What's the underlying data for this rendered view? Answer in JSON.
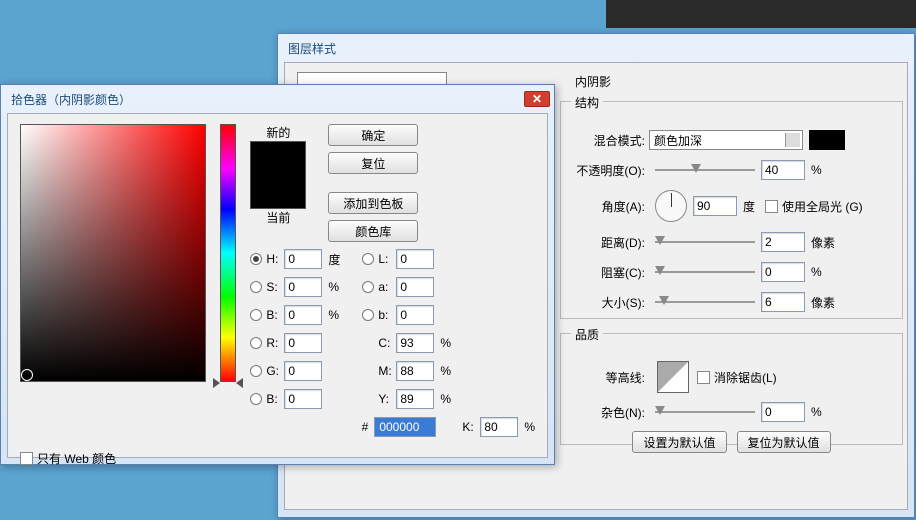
{
  "layerDialog": {
    "title": "图层样式",
    "section": "内阴影",
    "struct": {
      "legend": "结构",
      "blendModeLabel": "混合模式:",
      "blendMode": "颜色加深",
      "opacityLabel": "不透明度(O):",
      "opacity": "40",
      "opacityUnit": "%",
      "angleLabel": "角度(A):",
      "angle": "90",
      "angleUnit": "度",
      "globalLight": "使用全局光 (G)",
      "distanceLabel": "距离(D):",
      "distance": "2",
      "distanceUnit": "像素",
      "chokeLabel": "阻塞(C):",
      "choke": "0",
      "chokeUnit": "%",
      "sizeLabel": "大小(S):",
      "size": "6",
      "sizeUnit": "像素"
    },
    "quality": {
      "legend": "品质",
      "contourLabel": "等高线:",
      "antialias": "消除锯齿(L)",
      "noiseLabel": "杂色(N):",
      "noise": "0",
      "noiseUnit": "%"
    },
    "defaultBtn": "设置为默认值",
    "resetBtn": "复位为默认值"
  },
  "picker": {
    "title": "拾色器（内阴影颜色）",
    "newLabel": "新的",
    "currentLabel": "当前",
    "ok": "确定",
    "cancel": "复位",
    "add": "添加到色板",
    "lib": "颜色库",
    "H": {
      "l": "H:",
      "v": "0",
      "u": "度"
    },
    "S": {
      "l": "S:",
      "v": "0",
      "u": "%"
    },
    "Bv": {
      "l": "B:",
      "v": "0",
      "u": "%"
    },
    "R": {
      "l": "R:",
      "v": "0"
    },
    "G": {
      "l": "G:",
      "v": "0"
    },
    "Bc": {
      "l": "B:",
      "v": "0"
    },
    "L": {
      "l": "L:",
      "v": "0"
    },
    "a": {
      "l": "a:",
      "v": "0"
    },
    "b": {
      "l": "b:",
      "v": "0"
    },
    "C": {
      "l": "C:",
      "v": "93",
      "u": "%"
    },
    "M": {
      "l": "M:",
      "v": "88",
      "u": "%"
    },
    "Y": {
      "l": "Y:",
      "v": "89",
      "u": "%"
    },
    "K": {
      "l": "K:",
      "v": "80",
      "u": "%"
    },
    "hexLabel": "#",
    "hex": "000000",
    "webOnly": "只有 Web 颜色"
  }
}
